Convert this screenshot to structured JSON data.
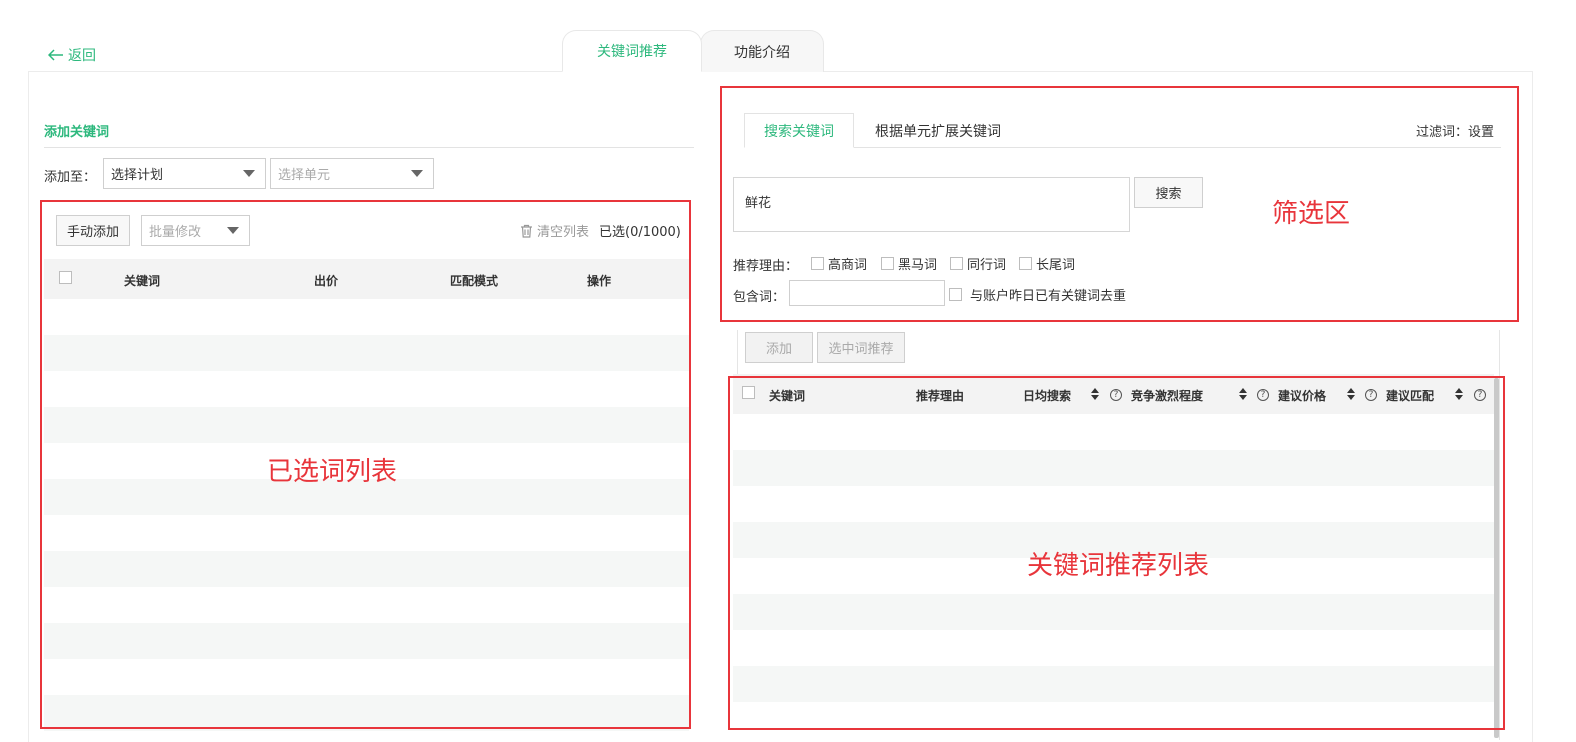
{
  "nav": {
    "back_label": "返回"
  },
  "top_tabs": [
    {
      "label": "关键词推荐",
      "active": true
    },
    {
      "label": "功能介绍",
      "active": false
    }
  ],
  "left": {
    "section_title": "添加关键词",
    "add_to_label": "添加至：",
    "plan_select": "选择计划",
    "unit_select": "选择单元",
    "manual_add_button": "手动添加",
    "batch_edit_select": "批量修改",
    "clear_list_label": "清空列表",
    "selected_count": "已选(0/1000)",
    "columns": [
      "关键词",
      "出价",
      "匹配模式",
      "操作"
    ],
    "annotation": "已选词列表"
  },
  "right": {
    "sub_tabs": [
      {
        "label": "搜索关键词",
        "active": true
      },
      {
        "label": "根据单元扩展关键词",
        "active": false
      }
    ],
    "filter_setting": "过滤词：设置",
    "search_value": "鲜花",
    "search_button": "搜索",
    "filter_annotation": "筛选区",
    "reason_label": "推荐理由：",
    "reason_options": [
      "高商词",
      "黑马词",
      "同行词",
      "长尾词"
    ],
    "include_label": "包含词：",
    "include_value": "",
    "dedupe_label": "与账户昨日已有关键词去重",
    "add_button": "添加",
    "recommend_selected_button": "选中词推荐",
    "columns": [
      "关键词",
      "推荐理由",
      "日均搜索",
      "竞争激烈程度",
      "建议价格",
      "建议匹配"
    ],
    "list_annotation": "关键词推荐列表"
  },
  "colors": {
    "accent": "#2db87d",
    "annotation_red": "#e8353b"
  }
}
